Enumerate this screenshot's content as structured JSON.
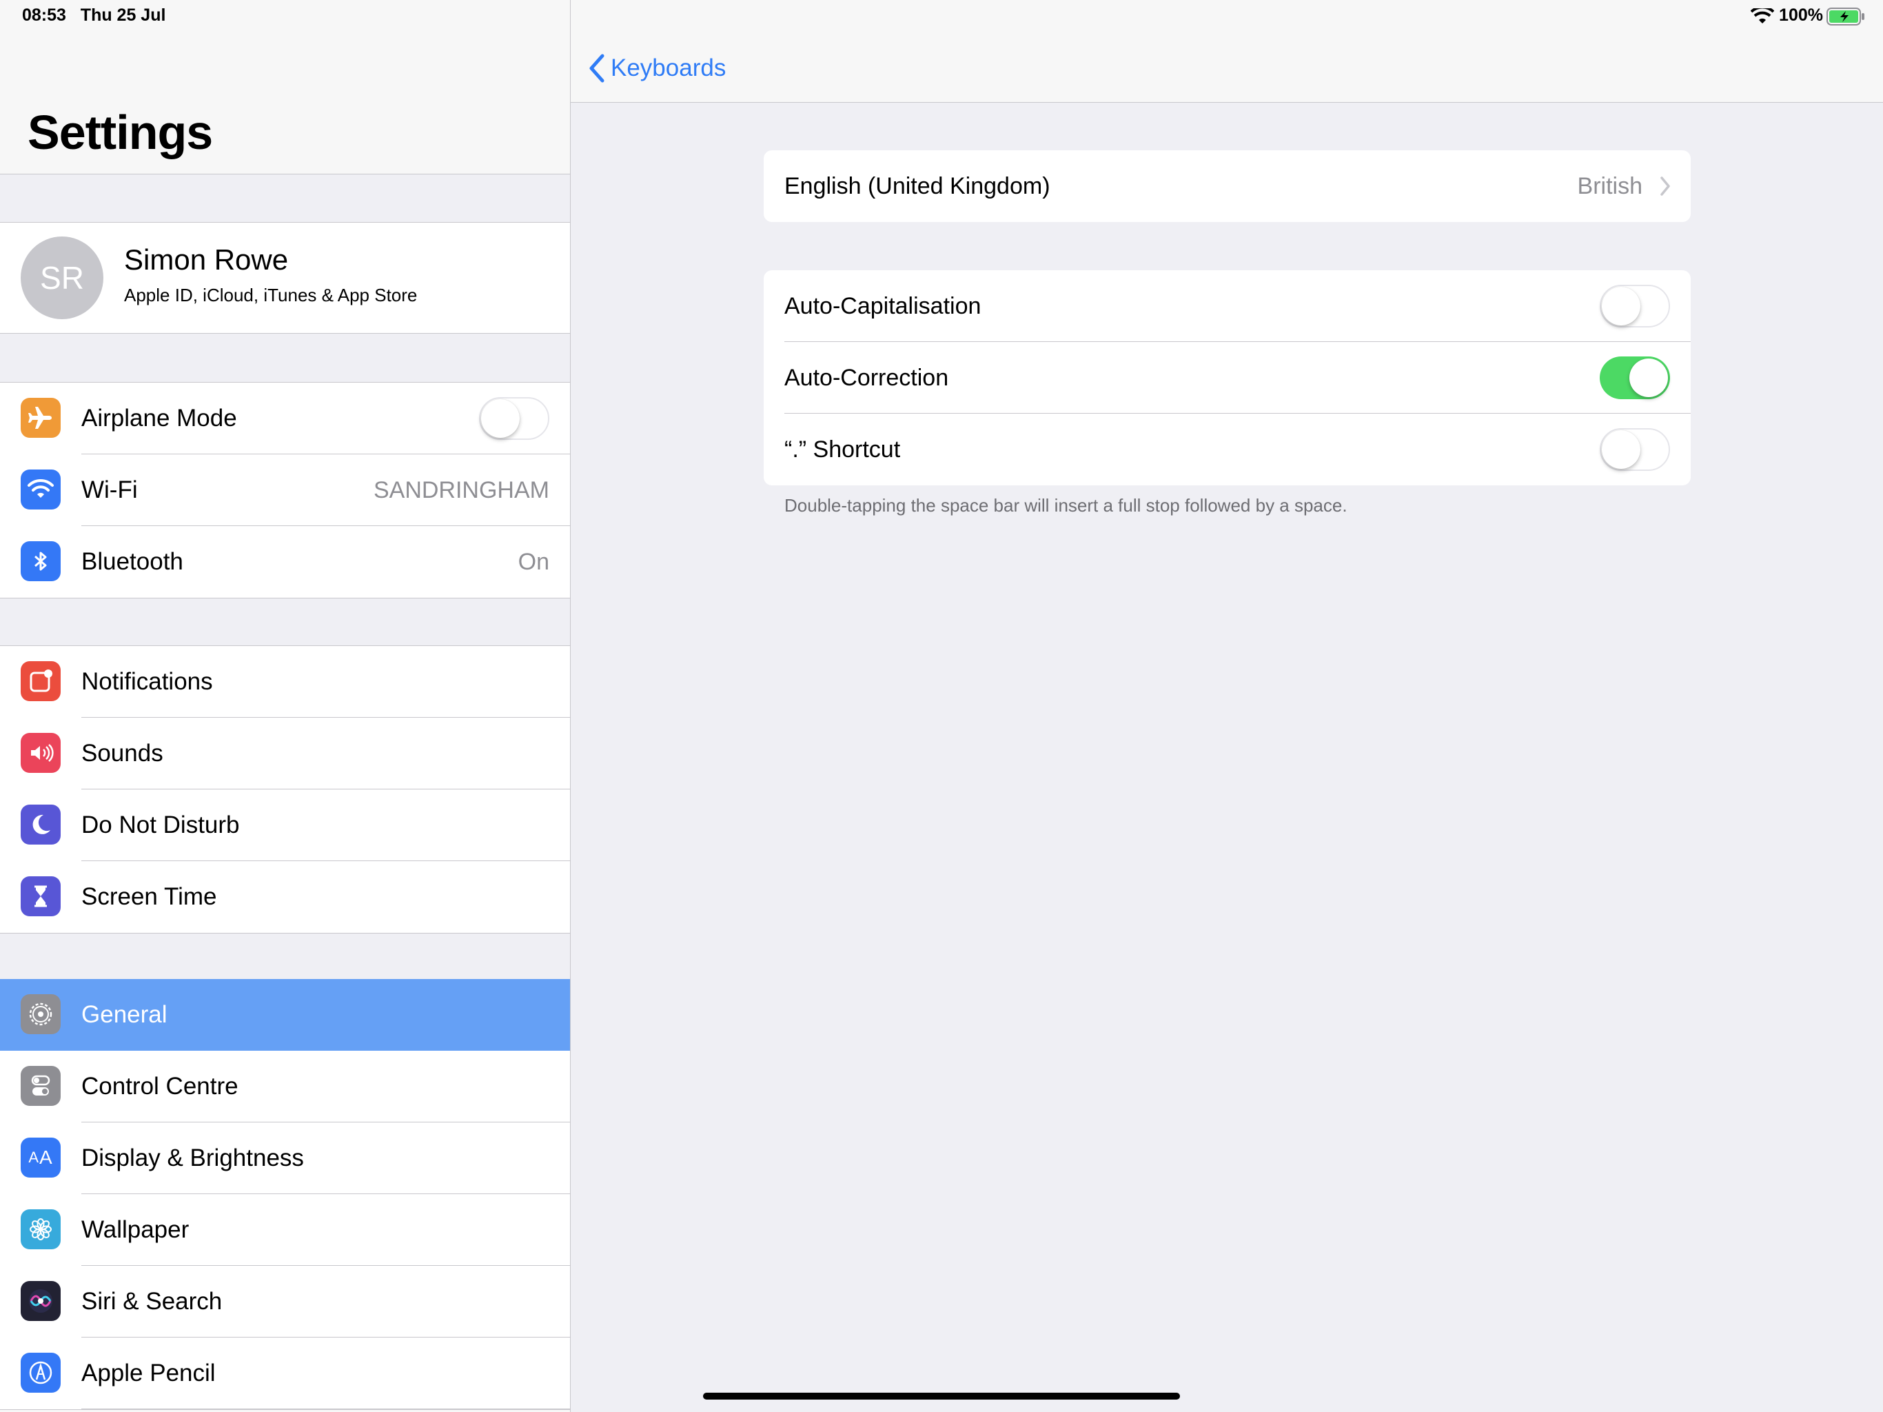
{
  "status_bar": {
    "time": "08:53",
    "date": "Thu 25 Jul",
    "battery": "100%"
  },
  "sidebar": {
    "title": "Settings",
    "profile": {
      "initials": "SR",
      "name": "Simon Rowe",
      "subtitle": "Apple ID, iCloud, iTunes & App Store"
    },
    "group1": [
      {
        "label": "Airplane Mode",
        "icon": "airplane-icon",
        "color": "#f09a37",
        "toggle": false
      },
      {
        "label": "Wi-Fi",
        "icon": "wifi-icon",
        "color": "#3478f6",
        "value": "SANDRINGHAM"
      },
      {
        "label": "Bluetooth",
        "icon": "bluetooth-icon",
        "color": "#3478f6",
        "value": "On"
      }
    ],
    "group2": [
      {
        "label": "Notifications",
        "icon": "notifications-icon",
        "color": "#eb4d3d"
      },
      {
        "label": "Sounds",
        "icon": "sounds-icon",
        "color": "#eb445a"
      },
      {
        "label": "Do Not Disturb",
        "icon": "moon-icon",
        "color": "#5856d6"
      },
      {
        "label": "Screen Time",
        "icon": "hourglass-icon",
        "color": "#5856d6"
      }
    ],
    "group3": [
      {
        "label": "General",
        "icon": "gear-icon",
        "color": "#8e8e93",
        "selected": true
      },
      {
        "label": "Control Centre",
        "icon": "control-centre-icon",
        "color": "#8e8e93"
      },
      {
        "label": "Display & Brightness",
        "icon": "display-icon",
        "color": "#3478f6"
      },
      {
        "label": "Wallpaper",
        "icon": "wallpaper-icon",
        "color": "#37aadc"
      },
      {
        "label": "Siri & Search",
        "icon": "siri-icon",
        "color": "#222233"
      },
      {
        "label": "Apple Pencil",
        "icon": "pencil-icon",
        "color": "#3478f6"
      }
    ]
  },
  "detail": {
    "back_label": "Keyboards",
    "language": {
      "label": "English (United Kingdom)",
      "value": "British"
    },
    "toggles": [
      {
        "label": "Auto-Capitalisation",
        "on": false
      },
      {
        "label": "Auto-Correction",
        "on": true
      },
      {
        "label": "“.” Shortcut",
        "on": false
      }
    ],
    "footnote": "Double-tapping the space bar will insert a full stop followed by a space."
  }
}
